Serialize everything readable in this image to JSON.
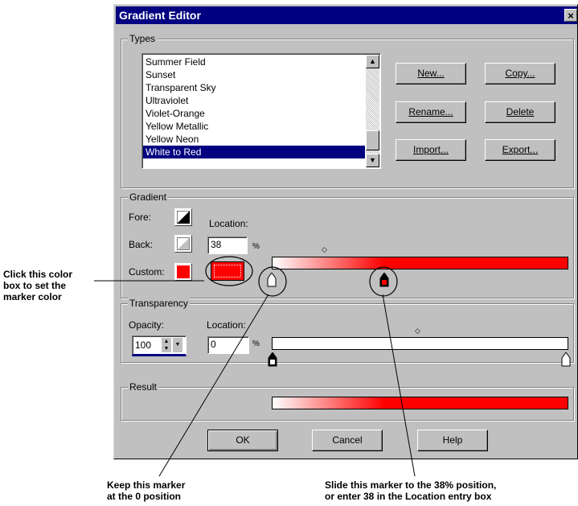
{
  "dialog": {
    "title": "Gradient Editor",
    "close": "×"
  },
  "types": {
    "legend": "Types",
    "items": [
      "Summer Field",
      "Sunset",
      "Transparent Sky",
      "Ultraviolet",
      "Violet-Orange",
      "Yellow Metallic",
      "Yellow Neon",
      "White to Red"
    ],
    "selected_index": 7,
    "buttons": {
      "new": "New...",
      "copy": "Copy...",
      "rename": "Rename...",
      "delete": "Delete",
      "import": "Import...",
      "export": "Export..."
    }
  },
  "gradient": {
    "legend": "Gradient",
    "fore_label": "Fore:",
    "back_label": "Back:",
    "custom_label": "Custom:",
    "location_label": "Location:",
    "location_value": "38",
    "percent": "%",
    "start_color": "#ffffff",
    "end_color": "#ff0000",
    "marker_color": "#ff0000",
    "marker_position": 0.38
  },
  "transparency": {
    "legend": "Transparency",
    "opacity_label": "Opacity:",
    "opacity_value": "100",
    "location_label": "Location:",
    "location_value": "0",
    "percent": "%"
  },
  "result": {
    "legend": "Result"
  },
  "footer": {
    "ok": "OK",
    "cancel": "Cancel",
    "help": "Help"
  },
  "annotations": {
    "color_box": [
      "Click this color",
      "box to set the",
      "marker color"
    ],
    "keep_marker": [
      "Keep this marker",
      "at the 0 position"
    ],
    "slide_marker": [
      "Slide this marker to the 38% position,",
      "or enter 38 in the Location entry box"
    ]
  }
}
